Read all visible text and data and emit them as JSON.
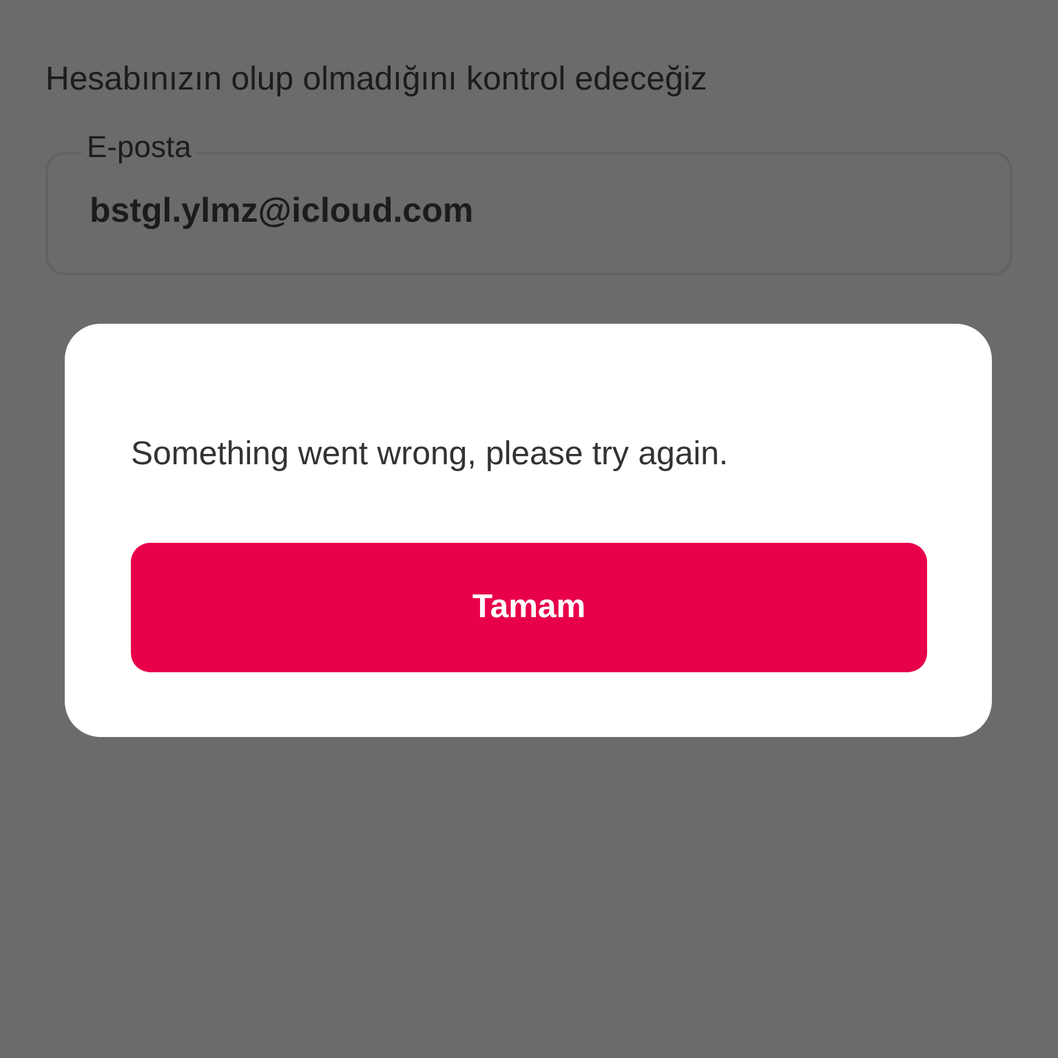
{
  "page": {
    "subtitle": "Hesabınızın olup olmadığını kontrol edeceğiz"
  },
  "email_field": {
    "label": "E-posta",
    "value": "bstgl.ylmz@icloud.com"
  },
  "dialog": {
    "message": "Something went wrong, please try again.",
    "button": "Tamam"
  }
}
